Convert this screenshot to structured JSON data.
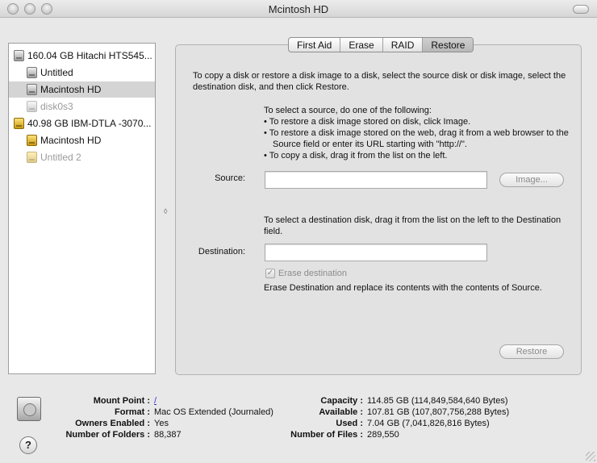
{
  "window": {
    "title": "Mcintosh HD"
  },
  "sidebar": {
    "items": [
      {
        "label": "160.04 GB Hitachi HTS545...",
        "icon": "gray-disk-icon",
        "indent": 0,
        "selected": false,
        "dim": false
      },
      {
        "label": "Untitled",
        "icon": "gray-volume-icon",
        "indent": 1,
        "selected": false,
        "dim": false
      },
      {
        "label": "Macintosh HD",
        "icon": "gray-volume-icon",
        "indent": 1,
        "selected": true,
        "dim": false
      },
      {
        "label": "disk0s3",
        "icon": "gray-volume-icon",
        "indent": 1,
        "selected": false,
        "dim": true
      },
      {
        "label": "40.98 GB IBM-DTLA -3070...",
        "icon": "gold-disk-icon",
        "indent": 0,
        "selected": false,
        "dim": false
      },
      {
        "label": "Macintosh HD",
        "icon": "gold-volume-icon",
        "indent": 1,
        "selected": false,
        "dim": false
      },
      {
        "label": "Untitled 2",
        "icon": "gold-volume-icon",
        "indent": 1,
        "selected": false,
        "dim": true
      }
    ]
  },
  "tabs": [
    {
      "label": "First Aid",
      "active": false
    },
    {
      "label": "Erase",
      "active": false
    },
    {
      "label": "RAID",
      "active": false
    },
    {
      "label": "Restore",
      "active": true
    }
  ],
  "restore": {
    "intro": "To copy a disk or restore a disk image to a disk, select the source disk or disk image, select the destination disk, and then click Restore.",
    "source_heading": "To select a source, do one of the following:",
    "source_bullets": [
      "To restore a disk image stored on disk, click Image.",
      "To restore a disk image stored on the web, drag it from a web browser to the Source field or enter its URL starting with \"http://\".",
      "To copy a disk, drag it from the list on the left."
    ],
    "source_label": "Source:",
    "source_value": "",
    "image_button": "Image...",
    "dest_instructions": "To select a destination disk, drag it from the list on the left to the Destination field.",
    "dest_label": "Destination:",
    "dest_value": "",
    "erase_checkbox_label": "Erase destination",
    "erase_checked": true,
    "erase_description": "Erase Destination and replace its contents with the contents of Source.",
    "restore_button": "Restore"
  },
  "info": {
    "left": [
      {
        "key": "Mount Point :",
        "value": "/",
        "link": true
      },
      {
        "key": "Format :",
        "value": "Mac OS Extended (Journaled)",
        "link": false
      },
      {
        "key": "Owners Enabled :",
        "value": "Yes",
        "link": false
      },
      {
        "key": "Number of Folders :",
        "value": "88,387",
        "link": false
      }
    ],
    "right": [
      {
        "key": "Capacity :",
        "value": "114.85 GB (114,849,584,640 Bytes)"
      },
      {
        "key": "Available :",
        "value": "107.81 GB (107,807,756,288 Bytes)"
      },
      {
        "key": "Used :",
        "value": "7.04 GB (7,041,826,816 Bytes)"
      },
      {
        "key": "Number of Files :",
        "value": "289,550"
      }
    ],
    "help_label": "?"
  }
}
